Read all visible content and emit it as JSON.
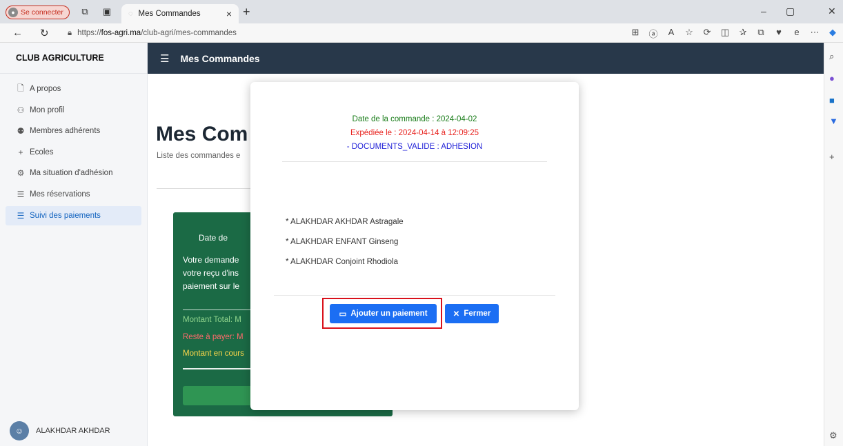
{
  "browser": {
    "profile_label": "Se connecter",
    "tab_title": "Mes Commandes",
    "url_prefix": "https://",
    "url_domain": "fos-agri.ma",
    "url_path": "/club-agri/mes-commandes"
  },
  "sidebar": {
    "brand": "CLUB AGRICULTURE",
    "items": [
      {
        "label": "A propos",
        "icon": "document-icon"
      },
      {
        "label": "Mon profil",
        "icon": "user-icon"
      },
      {
        "label": "Membres adhérents",
        "icon": "users-icon"
      },
      {
        "label": "Ecoles",
        "icon": "plus-icon"
      },
      {
        "label": "Ma situation d'adhésion",
        "icon": "gear-icon"
      },
      {
        "label": "Mes réservations",
        "icon": "list-icon"
      },
      {
        "label": "Suivi des paiements",
        "icon": "list-icon"
      }
    ],
    "active_index": 6,
    "user_name": "ALAKHDAR AKHDAR"
  },
  "header": {
    "title": "Mes Commandes"
  },
  "main": {
    "page_title": "Mes Com",
    "subtitle": "Liste des commandes e",
    "card": {
      "date_label": "Date de",
      "text_lines": [
        "Votre demande",
        "votre reçu d'ins",
        "paiement sur le"
      ],
      "total_label": "Montant Total: M",
      "reste_label": "Reste à payer: M",
      "encours_label": "Montant en cours"
    }
  },
  "modal": {
    "date_commande": "Date de la commande : 2024-04-02",
    "expediee": "Expédiée le : 2024-04-14 à 12:09:25",
    "documents": "- DOCUMENTS_VALIDE : ADHESION",
    "items": [
      "* ALAKHDAR AKHDAR Astragale",
      "* ALAKHDAR ENFANT Ginseng",
      "* ALAKHDAR Conjoint Rhodiola"
    ],
    "add_payment_label": "Ajouter un paiement",
    "close_label": "Fermer"
  },
  "colors": {
    "header_bg": "#28384a",
    "card_green": "#1b6a45",
    "primary_blue": "#1b6ef3",
    "highlight_red": "#d9111b"
  }
}
